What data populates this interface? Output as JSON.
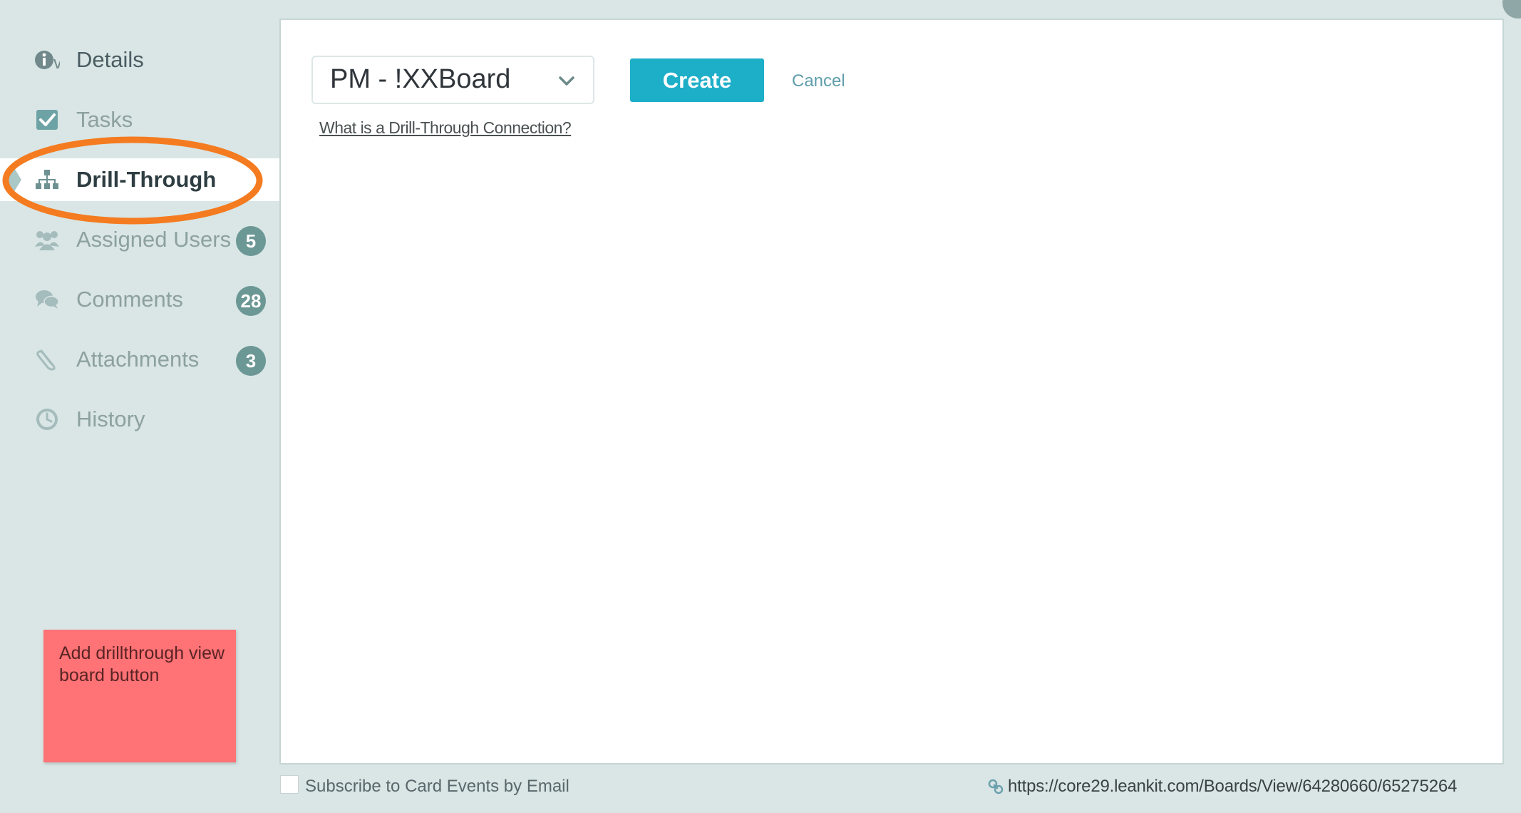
{
  "sidebar": {
    "items": [
      {
        "label": "Details",
        "icon": "info-icon"
      },
      {
        "label": "Tasks",
        "icon": "checkbox-icon"
      },
      {
        "label": "Drill-Through",
        "icon": "hierarchy-icon"
      },
      {
        "label": "Assigned Users",
        "icon": "users-icon",
        "badge": "5"
      },
      {
        "label": "Comments",
        "icon": "comments-icon",
        "badge": "28"
      },
      {
        "label": "Attachments",
        "icon": "paperclip-icon",
        "badge": "3"
      },
      {
        "label": "History",
        "icon": "clock-icon"
      }
    ],
    "active_item": "Drill-Through",
    "info_suffix": "v"
  },
  "sticky_note": {
    "text": "Add drillthrough view board button"
  },
  "drill_through": {
    "board_select_value": "PM - !XXBoard",
    "create_label": "Create",
    "cancel_label": "Cancel",
    "help_link": "What is a Drill-Through Connection?"
  },
  "footer": {
    "subscribe_label": "Subscribe to Card Events by Email",
    "subscribe_checked": false,
    "card_url": "https://core29.leankit.com/Boards/View/64280660/65275264"
  },
  "colors": {
    "background": "#d9e6e5",
    "accent_button": "#1daec8",
    "badge": "#6b9795",
    "highlight_ring": "#f47b20",
    "sticky_note": "#ff7275"
  }
}
